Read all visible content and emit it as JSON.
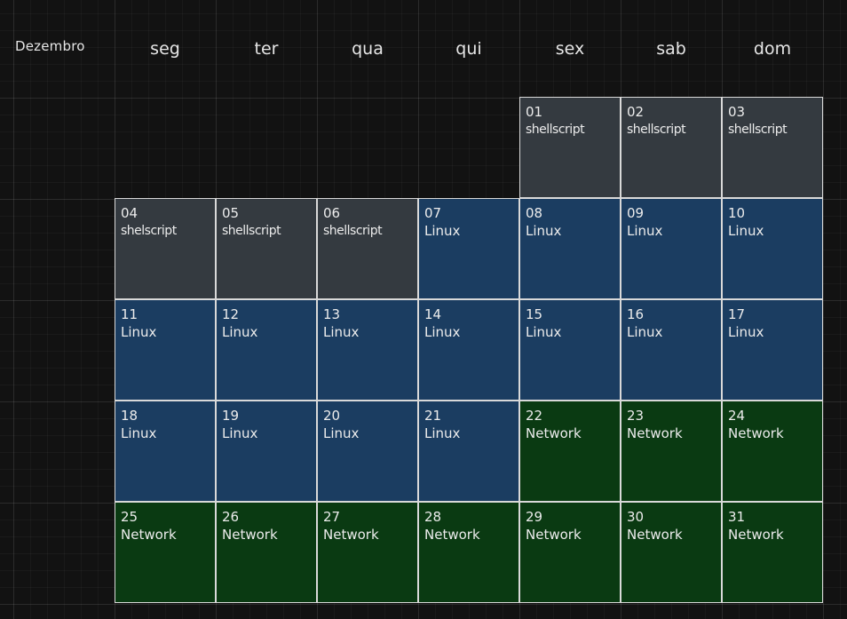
{
  "calendar": {
    "month": "Dezembro",
    "weekdays": [
      "seg",
      "ter",
      "qua",
      "qui",
      "sex",
      "sab",
      "dom"
    ],
    "colors": {
      "shellscript": "#343a40",
      "linux": "#1b3d61",
      "network": "#0a3a12",
      "background": "#121212"
    },
    "days": [
      {
        "num": "01",
        "topic": "shellscript"
      },
      {
        "num": "02",
        "topic": "shellscript"
      },
      {
        "num": "03",
        "topic": "shellscript"
      },
      {
        "num": "04",
        "topic": "shelscript"
      },
      {
        "num": "05",
        "topic": "shellscript"
      },
      {
        "num": "06",
        "topic": "shellscript"
      },
      {
        "num": "07",
        "topic": "Linux"
      },
      {
        "num": "08",
        "topic": "Linux"
      },
      {
        "num": "09",
        "topic": "Linux"
      },
      {
        "num": "10",
        "topic": "Linux"
      },
      {
        "num": "11",
        "topic": "Linux"
      },
      {
        "num": "12",
        "topic": "Linux"
      },
      {
        "num": "13",
        "topic": "Linux"
      },
      {
        "num": "14",
        "topic": "Linux"
      },
      {
        "num": "15",
        "topic": "Linux"
      },
      {
        "num": "16",
        "topic": "Linux"
      },
      {
        "num": "17",
        "topic": "Linux"
      },
      {
        "num": "18",
        "topic": "Linux"
      },
      {
        "num": "19",
        "topic": "Linux"
      },
      {
        "num": "20",
        "topic": "Linux"
      },
      {
        "num": "21",
        "topic": "Linux"
      },
      {
        "num": "22",
        "topic": "Network"
      },
      {
        "num": "23",
        "topic": "Network"
      },
      {
        "num": "24",
        "topic": "Network"
      },
      {
        "num": "25",
        "topic": "Network"
      },
      {
        "num": "26",
        "topic": "Network"
      },
      {
        "num": "27",
        "topic": "Network"
      },
      {
        "num": "28",
        "topic": "Network"
      },
      {
        "num": "29",
        "topic": "Network"
      },
      {
        "num": "30",
        "topic": "Network"
      },
      {
        "num": "31",
        "topic": "Network"
      }
    ]
  }
}
